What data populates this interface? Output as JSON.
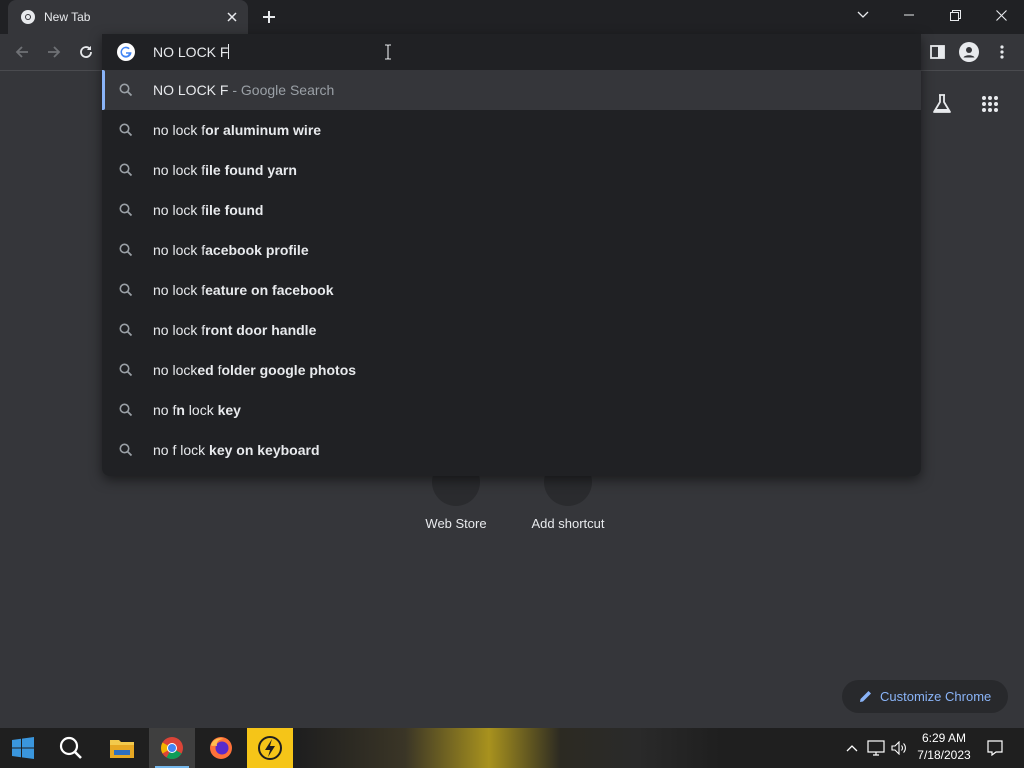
{
  "tab": {
    "title": "New Tab"
  },
  "omnibox": {
    "typed_text": "NO LOCK F"
  },
  "suggestions": [
    {
      "prefix": "NO LOCK F",
      "bold": "",
      "suffix": " - Google Search",
      "selected": true
    },
    {
      "prefix": "no lock f",
      "bold": "or aluminum wire",
      "suffix": ""
    },
    {
      "prefix": "no lock f",
      "bold": "ile found yarn",
      "suffix": ""
    },
    {
      "prefix": "no lock f",
      "bold": "ile found",
      "suffix": ""
    },
    {
      "prefix": "no lock f",
      "bold": "acebook profile",
      "suffix": ""
    },
    {
      "prefix": "no lock f",
      "bold": "eature on facebook",
      "suffix": ""
    },
    {
      "prefix": "no lock f",
      "bold": "ront door handle",
      "suffix": ""
    },
    {
      "prefix": "no lock",
      "bold": "ed folder google photos",
      "suffix": "",
      "mixed": [
        "no lock",
        "ed",
        " f",
        "older google photos"
      ]
    },
    {
      "prefix": "no f",
      "bold": "n",
      "suffix": "",
      "mixed": [
        "no f",
        "n",
        " lock ",
        "key"
      ]
    },
    {
      "prefix": "no f lock ",
      "bold": "key on keyboard",
      "suffix": ""
    }
  ],
  "shortcuts": [
    {
      "label": "Web Store"
    },
    {
      "label": "Add shortcut"
    }
  ],
  "customize": {
    "label": "Customize Chrome"
  },
  "clock": {
    "time": "6:29 AM",
    "date": "7/18/2023"
  },
  "colors": {
    "accent": "#8ab4f8",
    "background": "#35363a",
    "popup": "#202124"
  },
  "icons": [
    "chrome-icon",
    "close-icon",
    "plus-icon",
    "chevron-down-icon",
    "minimize-icon",
    "restore-icon",
    "back-icon",
    "forward-icon",
    "reload-icon",
    "google-icon",
    "search-icon",
    "side-panel-icon",
    "profile-icon",
    "menu-icon",
    "labs-icon",
    "apps-icon",
    "pencil-icon",
    "windows-icon",
    "file-explorer-icon",
    "firefox-icon",
    "lightning-app-icon",
    "chevron-up-icon",
    "network-icon",
    "volume-icon",
    "notification-icon"
  ]
}
